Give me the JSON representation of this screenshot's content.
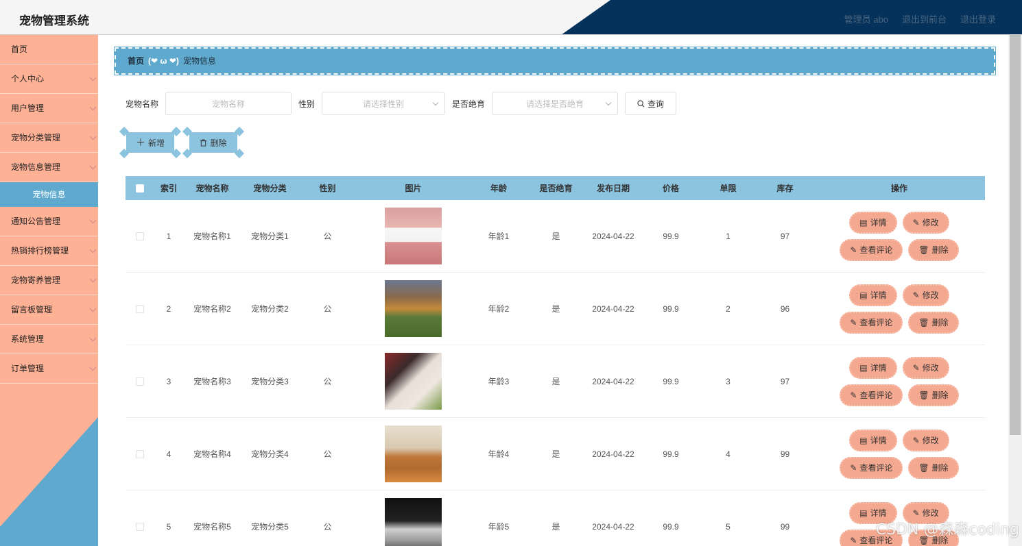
{
  "header": {
    "title": "宠物管理系统",
    "links": [
      "管理员 abo",
      "退出到前台",
      "退出登录"
    ]
  },
  "sidebar": {
    "items": [
      {
        "label": "首页",
        "chevron": false
      },
      {
        "label": "个人中心",
        "chevron": true
      },
      {
        "label": "用户管理",
        "chevron": true
      },
      {
        "label": "宠物分类管理",
        "chevron": true
      },
      {
        "label": "宠物信息管理",
        "chevron": true
      }
    ],
    "active_sub": "宠物信息",
    "items_after": [
      {
        "label": "通知公告管理",
        "chevron": true
      },
      {
        "label": "热销排行榜管理",
        "chevron": true
      },
      {
        "label": "宠物寄养管理",
        "chevron": true
      },
      {
        "label": "留言板管理",
        "chevron": true
      },
      {
        "label": "系统管理",
        "chevron": true
      },
      {
        "label": "订单管理",
        "chevron": true
      }
    ]
  },
  "breadcrumb": {
    "home": "首页",
    "separator": "(❤ ω ❤)",
    "current": "宠物信息"
  },
  "search": {
    "name_label": "宠物名称",
    "name_placeholder": "宠物名称",
    "sex_label": "性别",
    "sex_placeholder": "请选择性别",
    "neuter_label": "是否绝育",
    "neuter_placeholder": "请选择是否绝育",
    "query_label": "查询"
  },
  "actions": {
    "add_label": "新增",
    "delete_label": "删除"
  },
  "table": {
    "headers": [
      "索引",
      "宠物名称",
      "宠物分类",
      "性别",
      "图片",
      "年龄",
      "是否绝育",
      "发布日期",
      "价格",
      "单限",
      "库存",
      "操作"
    ],
    "rows": [
      {
        "index": "1",
        "name": "宠物名称1",
        "category": "宠物分类1",
        "sex": "公",
        "age": "年龄1",
        "neutered": "是",
        "date": "2024-04-22",
        "price": "99.9",
        "limit": "1",
        "stock": "97"
      },
      {
        "index": "2",
        "name": "宠物名称2",
        "category": "宠物分类2",
        "sex": "公",
        "age": "年龄2",
        "neutered": "是",
        "date": "2024-04-22",
        "price": "99.9",
        "limit": "2",
        "stock": "96"
      },
      {
        "index": "3",
        "name": "宠物名称3",
        "category": "宠物分类3",
        "sex": "公",
        "age": "年龄3",
        "neutered": "是",
        "date": "2024-04-22",
        "price": "99.9",
        "limit": "3",
        "stock": "97"
      },
      {
        "index": "4",
        "name": "宠物名称4",
        "category": "宠物分类4",
        "sex": "公",
        "age": "年龄4",
        "neutered": "是",
        "date": "2024-04-22",
        "price": "99.9",
        "limit": "4",
        "stock": "99"
      },
      {
        "index": "5",
        "name": "宠物名称5",
        "category": "宠物分类5",
        "sex": "公",
        "age": "年龄5",
        "neutered": "是",
        "date": "2024-04-22",
        "price": "99.9",
        "limit": "5",
        "stock": "99"
      }
    ],
    "op_labels": {
      "detail": "详情",
      "edit": "修改",
      "comments": "查看评论",
      "delete": "删除"
    }
  },
  "watermark": "CSDN @森森coding",
  "colors": {
    "sidebar": "#ffb196",
    "accent_blue": "#5fa9cf",
    "table_header": "#8cc3de",
    "navy": "#05325a",
    "op_button": "#f4a88f"
  }
}
